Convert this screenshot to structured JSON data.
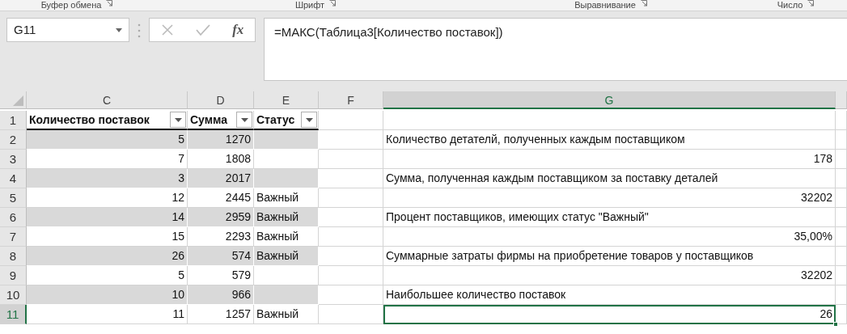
{
  "ribbon_groups": [
    {
      "label": "Буфер обмена"
    },
    {
      "label": "Шрифт"
    },
    {
      "label": "Выравнивание"
    },
    {
      "label": "Число"
    }
  ],
  "name_box": {
    "value": "G11"
  },
  "formula_bar": {
    "function_label": "fx",
    "formula": "=МАКС(Таблица3[Количество поставок])"
  },
  "sheet": {
    "columns": [
      {
        "label": "C",
        "selected": false
      },
      {
        "label": "D",
        "selected": false
      },
      {
        "label": "E",
        "selected": false
      },
      {
        "label": "F",
        "selected": false
      },
      {
        "label": "G",
        "selected": true
      }
    ],
    "rows": [
      {
        "number": "1",
        "selected": false,
        "banded": false,
        "cells": [
          {
            "kind": "header",
            "value": "Количество поставок"
          },
          {
            "kind": "header",
            "value": "Сумма"
          },
          {
            "kind": "header",
            "value": "Статус"
          },
          {
            "kind": "empty"
          },
          {
            "kind": "empty"
          }
        ]
      },
      {
        "number": "2",
        "selected": false,
        "banded": true,
        "cells": [
          {
            "kind": "number",
            "value": "5"
          },
          {
            "kind": "number",
            "value": "1270"
          },
          {
            "kind": "empty"
          },
          {
            "kind": "empty"
          },
          {
            "kind": "text",
            "value": "Количество детателй, полученных каждым поставщиком"
          }
        ]
      },
      {
        "number": "3",
        "selected": false,
        "banded": false,
        "cells": [
          {
            "kind": "number",
            "value": "7"
          },
          {
            "kind": "number",
            "value": "1808"
          },
          {
            "kind": "empty"
          },
          {
            "kind": "empty"
          },
          {
            "kind": "number",
            "value": "178"
          }
        ]
      },
      {
        "number": "4",
        "selected": false,
        "banded": true,
        "cells": [
          {
            "kind": "number",
            "value": "3"
          },
          {
            "kind": "number",
            "value": "2017"
          },
          {
            "kind": "empty"
          },
          {
            "kind": "empty"
          },
          {
            "kind": "text",
            "value": "Сумма, полученная каждым поставщиком за поставку деталей"
          }
        ]
      },
      {
        "number": "5",
        "selected": false,
        "banded": false,
        "cells": [
          {
            "kind": "number",
            "value": "12"
          },
          {
            "kind": "number",
            "value": "2445"
          },
          {
            "kind": "text",
            "value": "Важный"
          },
          {
            "kind": "empty"
          },
          {
            "kind": "number",
            "value": "32202"
          }
        ]
      },
      {
        "number": "6",
        "selected": false,
        "banded": true,
        "cells": [
          {
            "kind": "number",
            "value": "14"
          },
          {
            "kind": "number",
            "value": "2959"
          },
          {
            "kind": "text",
            "value": "Важный"
          },
          {
            "kind": "empty"
          },
          {
            "kind": "text",
            "value": "Процент поставщиков, имеющих статус \"Важный\""
          }
        ]
      },
      {
        "number": "7",
        "selected": false,
        "banded": false,
        "cells": [
          {
            "kind": "number",
            "value": "15"
          },
          {
            "kind": "number",
            "value": "2293"
          },
          {
            "kind": "text",
            "value": "Важный"
          },
          {
            "kind": "empty"
          },
          {
            "kind": "number",
            "value": "35,00%"
          }
        ]
      },
      {
        "number": "8",
        "selected": false,
        "banded": true,
        "cells": [
          {
            "kind": "number",
            "value": "26"
          },
          {
            "kind": "number",
            "value": "574"
          },
          {
            "kind": "text",
            "value": "Важный"
          },
          {
            "kind": "empty"
          },
          {
            "kind": "text",
            "value": "Суммарные затраты фирмы на приобретение товаров у поставщиков"
          }
        ]
      },
      {
        "number": "9",
        "selected": false,
        "banded": false,
        "cells": [
          {
            "kind": "number",
            "value": "5"
          },
          {
            "kind": "number",
            "value": "579"
          },
          {
            "kind": "empty"
          },
          {
            "kind": "empty"
          },
          {
            "kind": "number",
            "value": "32202"
          }
        ]
      },
      {
        "number": "10",
        "selected": false,
        "banded": true,
        "cells": [
          {
            "kind": "number",
            "value": "10"
          },
          {
            "kind": "number",
            "value": "966"
          },
          {
            "kind": "empty"
          },
          {
            "kind": "empty"
          },
          {
            "kind": "text",
            "value": "Наибольшее количество поставок"
          }
        ]
      },
      {
        "number": "11",
        "selected": true,
        "banded": false,
        "cells": [
          {
            "kind": "number",
            "value": "11"
          },
          {
            "kind": "number",
            "value": "1257"
          },
          {
            "kind": "text",
            "value": "Важный"
          },
          {
            "kind": "empty"
          },
          {
            "kind": "number",
            "value": "26"
          }
        ]
      }
    ]
  }
}
